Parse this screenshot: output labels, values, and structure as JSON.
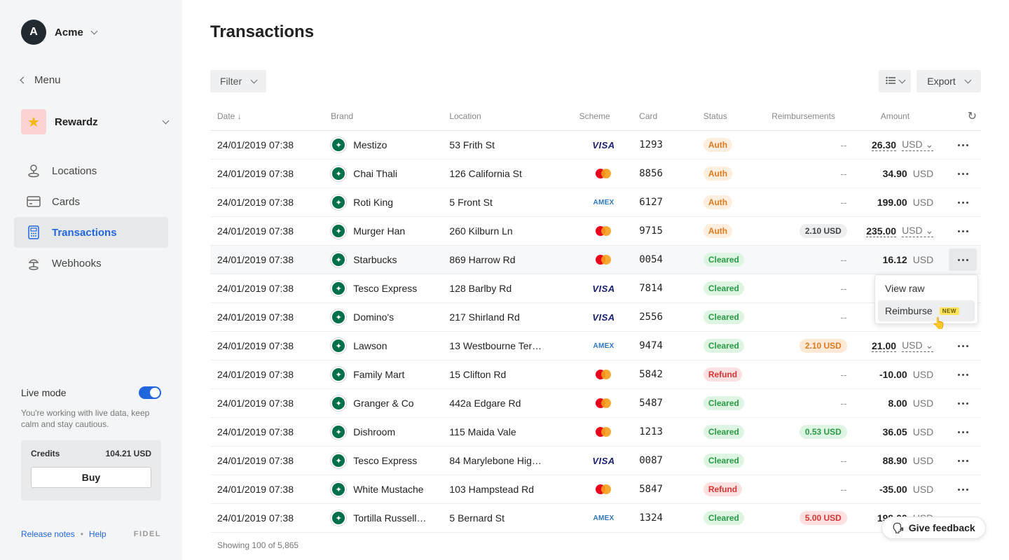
{
  "org": {
    "initial": "A",
    "name": "Acme"
  },
  "sidebar": {
    "menu_label": "Menu",
    "app": {
      "name": "Rewardz",
      "icon": "star-icon"
    },
    "items": [
      {
        "label": "Locations",
        "icon": "location-pin-icon",
        "active": false
      },
      {
        "label": "Cards",
        "icon": "credit-card-icon",
        "active": false
      },
      {
        "label": "Transactions",
        "icon": "calculator-icon",
        "active": true
      },
      {
        "label": "Webhooks",
        "icon": "webhook-icon",
        "active": false
      }
    ],
    "live_mode": {
      "label": "Live mode",
      "on": true,
      "description": "You're working with live data, keep calm and stay cautious."
    },
    "credits": {
      "label": "Credits",
      "value": "104.21 USD",
      "buy_label": "Buy"
    },
    "footer": {
      "release_notes": "Release notes",
      "separator": "•",
      "help": "Help",
      "logo": "FIDEL"
    }
  },
  "page": {
    "title": "Transactions",
    "filter_label": "Filter",
    "export_label": "Export",
    "showing": "Showing 100 of 5,865",
    "feedback_label": "Give feedback"
  },
  "columns": {
    "date": "Date ↓",
    "brand": "Brand",
    "location": "Location",
    "scheme": "Scheme",
    "card": "Card",
    "status": "Status",
    "reimbursements": "Reimbursements",
    "amount": "Amount"
  },
  "rows": [
    {
      "date": "24/01/2019 07:38",
      "brand": "Mestizo",
      "location": "53 Frith St",
      "scheme": "VISA",
      "card": "1293",
      "status": "Auth",
      "reimb": "--",
      "reimb_style": "dash",
      "amount": "26.30",
      "currency": "USD",
      "amount_dd": true
    },
    {
      "date": "24/01/2019 07:38",
      "brand": "Chai Thali",
      "location": "126 California St",
      "scheme": "MC",
      "card": "8856",
      "status": "Auth",
      "reimb": "--",
      "reimb_style": "dash",
      "amount": "34.90",
      "currency": "USD",
      "amount_dd": false
    },
    {
      "date": "24/01/2019 07:38",
      "brand": "Roti King",
      "location": "5 Front St",
      "scheme": "AMEX",
      "card": "6127",
      "status": "Auth",
      "reimb": "--",
      "reimb_style": "dash",
      "amount": "199.00",
      "currency": "USD",
      "amount_dd": false
    },
    {
      "date": "24/01/2019 07:38",
      "brand": "Murger Han",
      "location": "260 Kilburn Ln",
      "scheme": "MC",
      "card": "9715",
      "status": "Auth",
      "reimb": "2.10 USD",
      "reimb_style": "grey",
      "amount": "235.00",
      "currency": "USD",
      "amount_dd": true
    },
    {
      "date": "24/01/2019 07:38",
      "brand": "Starbucks",
      "location": "869 Harrow Rd",
      "scheme": "MC",
      "card": "0054",
      "status": "Cleared",
      "reimb": "--",
      "reimb_style": "dash",
      "amount": "16.12",
      "currency": "USD",
      "amount_dd": false,
      "hover": true,
      "menu_open": true
    },
    {
      "date": "24/01/2019 07:38",
      "brand": "Tesco Express",
      "location": "128 Barlby Rd",
      "scheme": "VISA",
      "card": "7814",
      "status": "Cleared",
      "reimb": "--",
      "reimb_style": "dash",
      "amount": "",
      "currency": "",
      "amount_dd": false,
      "hidden_tail": true
    },
    {
      "date": "24/01/2019 07:38",
      "brand": "Domino's",
      "location": "217 Shirland Rd",
      "scheme": "VISA",
      "card": "2556",
      "status": "Cleared",
      "reimb": "--",
      "reimb_style": "dash",
      "amount": "",
      "currency": "",
      "amount_dd": false,
      "hidden_tail": true
    },
    {
      "date": "24/01/2019 07:38",
      "brand": "Lawson",
      "location": "13 Westbourne Ter…",
      "scheme": "AMEX",
      "card": "9474",
      "status": "Cleared",
      "reimb": "2.10 USD",
      "reimb_style": "orange",
      "amount": "21.00",
      "currency": "USD",
      "amount_dd": true
    },
    {
      "date": "24/01/2019 07:38",
      "brand": "Family Mart",
      "location": "15 Clifton Rd",
      "scheme": "MC",
      "card": "5842",
      "status": "Refund",
      "reimb": "--",
      "reimb_style": "dash",
      "amount": "-10.00",
      "currency": "USD",
      "amount_dd": false
    },
    {
      "date": "24/01/2019 07:38",
      "brand": "Granger & Co",
      "location": "442a Edgare Rd",
      "scheme": "MC",
      "card": "5487",
      "status": "Cleared",
      "reimb": "--",
      "reimb_style": "dash",
      "amount": "8.00",
      "currency": "USD",
      "amount_dd": false
    },
    {
      "date": "24/01/2019 07:38",
      "brand": "Dishroom",
      "location": "115 Maida Vale",
      "scheme": "MC",
      "card": "1213",
      "status": "Cleared",
      "reimb": "0.53 USD",
      "reimb_style": "green",
      "amount": "36.05",
      "currency": "USD",
      "amount_dd": false
    },
    {
      "date": "24/01/2019 07:38",
      "brand": "Tesco Express",
      "location": "84 Marylebone Hig…",
      "scheme": "VISA",
      "card": "0087",
      "status": "Cleared",
      "reimb": "--",
      "reimb_style": "dash",
      "amount": "88.90",
      "currency": "USD",
      "amount_dd": false
    },
    {
      "date": "24/01/2019 07:38",
      "brand": "White Mustache",
      "location": "103 Hampstead Rd",
      "scheme": "MC",
      "card": "5847",
      "status": "Refund",
      "reimb": "--",
      "reimb_style": "dash",
      "amount": "-35.00",
      "currency": "USD",
      "amount_dd": false
    },
    {
      "date": "24/01/2019 07:38",
      "brand": "Tortilla Russell…",
      "location": "5 Bernard St",
      "scheme": "AMEX",
      "card": "1324",
      "status": "Cleared",
      "reimb": "5.00 USD",
      "reimb_style": "red",
      "amount": "199.00",
      "currency": "USD",
      "amount_dd": false
    }
  ],
  "row_menu": {
    "items": [
      {
        "label": "View raw"
      },
      {
        "label": "Reimburse",
        "tag": "NEW",
        "highlighted": true
      }
    ]
  },
  "colors": {
    "accent": "#2266dd",
    "auth": "#e07a1f",
    "cleared": "#2a9b45",
    "refund": "#d93434"
  }
}
